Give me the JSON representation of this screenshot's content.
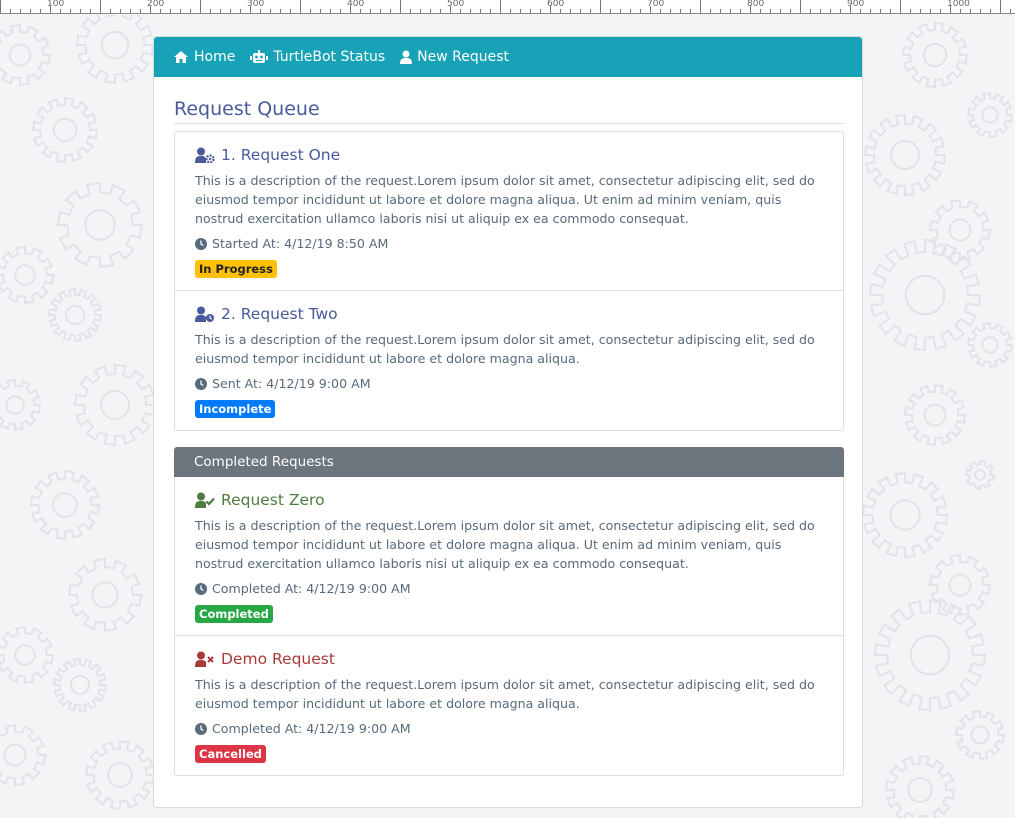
{
  "ruler": {
    "labels": [
      "100",
      "200",
      "300",
      "400",
      "500",
      "600",
      "700",
      "800",
      "900",
      "1000"
    ]
  },
  "nav": {
    "home": "Home",
    "status": "TurtleBot Status",
    "new_request": "New Request"
  },
  "queue": {
    "title": "Request Queue",
    "items": [
      {
        "title": "1. Request One",
        "description": "This is a description of the request.Lorem ipsum dolor sit amet, consectetur adipiscing elit, sed do eiusmod tempor incididunt ut labore et dolore magna aliqua. Ut enim ad minim veniam, quis nostrud exercitation ullamco laboris nisi ut aliquip ex ea commodo consequat.",
        "meta": "Started At: 4/12/19 8:50 AM",
        "badge": "In Progress"
      },
      {
        "title": "2. Request Two",
        "description": "This is a description of the request.Lorem ipsum dolor sit amet, consectetur adipiscing elit, sed do eiusmod tempor incididunt ut labore et dolore magna aliqua.",
        "meta": "Sent At: 4/12/19 9:00 AM",
        "badge": "Incomplete"
      }
    ]
  },
  "completed": {
    "header": "Completed Requests",
    "items": [
      {
        "title": "Request Zero",
        "description": "This is a description of the request.Lorem ipsum dolor sit amet, consectetur adipiscing elit, sed do eiusmod tempor incididunt ut labore et dolore magna aliqua. Ut enim ad minim veniam, quis nostrud exercitation ullamco laboris nisi ut aliquip ex ea commodo consequat.",
        "meta": "Completed At: 4/12/19 9:00 AM",
        "badge": "Completed"
      },
      {
        "title": "Demo Request",
        "description": "This is a description of the request.Lorem ipsum dolor sit amet, consectetur adipiscing elit, sed do eiusmod tempor incididunt ut labore et dolore magna aliqua.",
        "meta": "Completed At: 4/12/19 9:00 AM",
        "badge": "Cancelled"
      }
    ]
  },
  "colors": {
    "navbar": "#17a2b8",
    "in_progress": "#ffc107",
    "incomplete": "#007bff",
    "completed": "#28a745",
    "cancelled": "#dc3545",
    "completed_header": "#6c757d"
  },
  "icons": {
    "home": "home-icon",
    "status": "robot-icon",
    "new_request": "user-icon",
    "request_one": "user-gear-icon",
    "request_two": "user-clock-icon",
    "request_zero": "user-check-icon",
    "demo_request": "user-x-icon",
    "clock": "clock-icon"
  }
}
